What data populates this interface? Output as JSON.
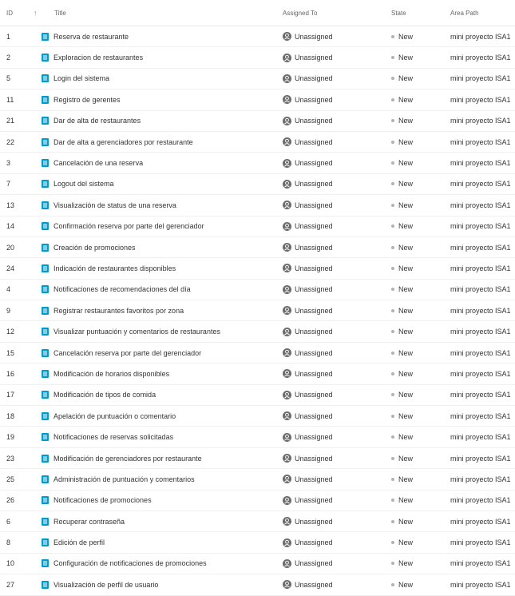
{
  "header": {
    "id_label": "ID",
    "title_label": "Title",
    "assigned_label": "Assigned To",
    "state_label": "State",
    "area_label": "Area Path"
  },
  "colors": {
    "story_icon": "#009ccc",
    "state_new": "#b2b2b2",
    "avatar": "#6d6d6d"
  },
  "rows": [
    {
      "id": "1",
      "title": "Reserva de restaurante",
      "assigned": "Unassigned",
      "state": "New",
      "area": "mini proyecto ISA1"
    },
    {
      "id": "2",
      "title": "Exploracion de restaurantes",
      "assigned": "Unassigned",
      "state": "New",
      "area": "mini proyecto ISA1"
    },
    {
      "id": "5",
      "title": "Login del sistema",
      "assigned": "Unassigned",
      "state": "New",
      "area": "mini proyecto ISA1"
    },
    {
      "id": "11",
      "title": "Registro de gerentes",
      "assigned": "Unassigned",
      "state": "New",
      "area": "mini proyecto ISA1"
    },
    {
      "id": "21",
      "title": "Dar de alta de restaurantes",
      "assigned": "Unassigned",
      "state": "New",
      "area": "mini proyecto ISA1"
    },
    {
      "id": "22",
      "title": "Dar de alta a gerenciadores por restaurante",
      "assigned": "Unassigned",
      "state": "New",
      "area": "mini proyecto ISA1"
    },
    {
      "id": "3",
      "title": "Cancelación de una reserva",
      "assigned": "Unassigned",
      "state": "New",
      "area": "mini proyecto ISA1"
    },
    {
      "id": "7",
      "title": "Logout del sistema",
      "assigned": "Unassigned",
      "state": "New",
      "area": "mini proyecto ISA1"
    },
    {
      "id": "13",
      "title": "Visualización de status de una reserva",
      "assigned": "Unassigned",
      "state": "New",
      "area": "mini proyecto ISA1"
    },
    {
      "id": "14",
      "title": "Confirmación reserva por parte del gerenciador",
      "assigned": "Unassigned",
      "state": "New",
      "area": "mini proyecto ISA1"
    },
    {
      "id": "20",
      "title": "Creación de promociones",
      "assigned": "Unassigned",
      "state": "New",
      "area": "mini proyecto ISA1"
    },
    {
      "id": "24",
      "title": "Indicación de restaurantes disponibles",
      "assigned": "Unassigned",
      "state": "New",
      "area": "mini proyecto ISA1"
    },
    {
      "id": "4",
      "title": "Notificaciones de recomendaciones del día",
      "assigned": "Unassigned",
      "state": "New",
      "area": "mini proyecto ISA1"
    },
    {
      "id": "9",
      "title": "Registrar restaurantes favoritos por zona",
      "assigned": "Unassigned",
      "state": "New",
      "area": "mini proyecto ISA1"
    },
    {
      "id": "12",
      "title": "Visualizar puntuación y comentarios de restaurantes",
      "assigned": "Unassigned",
      "state": "New",
      "area": "mini proyecto ISA1"
    },
    {
      "id": "15",
      "title": "Cancelación reserva por parte del gerenciador",
      "assigned": "Unassigned",
      "state": "New",
      "area": "mini proyecto ISA1"
    },
    {
      "id": "16",
      "title": "Modificación de horarios disponibles",
      "assigned": "Unassigned",
      "state": "New",
      "area": "mini proyecto ISA1"
    },
    {
      "id": "17",
      "title": "Modificación de tipos de comida",
      "assigned": "Unassigned",
      "state": "New",
      "area": "mini proyecto ISA1"
    },
    {
      "id": "18",
      "title": "Apelación de puntuación o comentario",
      "assigned": "Unassigned",
      "state": "New",
      "area": "mini proyecto ISA1"
    },
    {
      "id": "19",
      "title": "Notificaciones de reservas solicitadas",
      "assigned": "Unassigned",
      "state": "New",
      "area": "mini proyecto ISA1"
    },
    {
      "id": "23",
      "title": "Modificación de gerenciadores por restaurante",
      "assigned": "Unassigned",
      "state": "New",
      "area": "mini proyecto ISA1"
    },
    {
      "id": "25",
      "title": "Administración de puntuación y comentarios",
      "assigned": "Unassigned",
      "state": "New",
      "area": "mini proyecto ISA1"
    },
    {
      "id": "26",
      "title": "Notificaciones de promociones",
      "assigned": "Unassigned",
      "state": "New",
      "area": "mini proyecto ISA1"
    },
    {
      "id": "6",
      "title": "Recuperar contraseña",
      "assigned": "Unassigned",
      "state": "New",
      "area": "mini proyecto ISA1"
    },
    {
      "id": "8",
      "title": "Edición de perfil",
      "assigned": "Unassigned",
      "state": "New",
      "area": "mini proyecto ISA1"
    },
    {
      "id": "10",
      "title": "Configuración de notificaciones de promociones",
      "assigned": "Unassigned",
      "state": "New",
      "area": "mini proyecto ISA1"
    },
    {
      "id": "27",
      "title": "Visualización de perfil de usuario",
      "assigned": "Unassigned",
      "state": "New",
      "area": "mini proyecto ISA1"
    }
  ]
}
